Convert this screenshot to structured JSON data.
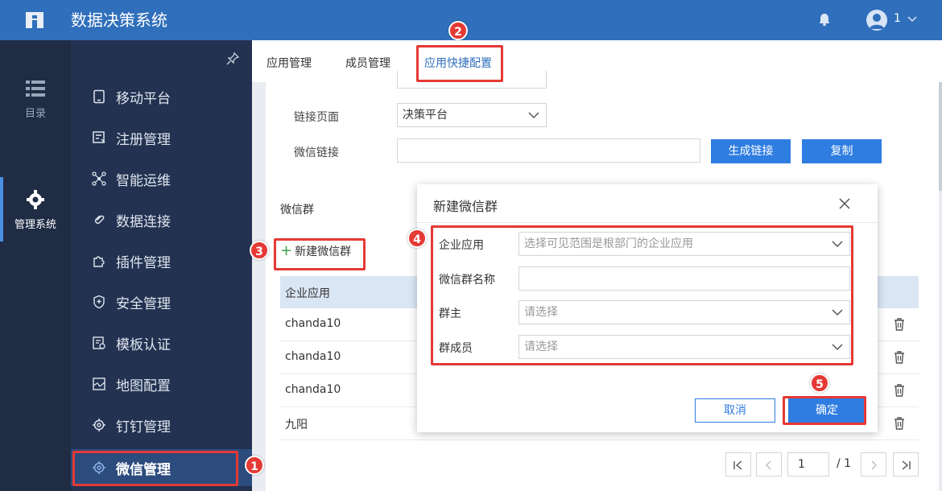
{
  "header": {
    "title": "数据决策系统",
    "logo_icon": "fine-logo-icon",
    "notification_icon": "bell-icon",
    "user": {
      "avatar_icon": "user-avatar-icon",
      "name": "1",
      "chevron_icon": "chevron-down-icon"
    }
  },
  "rail": {
    "items": [
      {
        "label": "目录",
        "icon": "list-icon"
      },
      {
        "label": "管理系统",
        "icon": "gear-icon"
      }
    ]
  },
  "sidebar": {
    "pin_icon": "pin-icon",
    "items": [
      {
        "label": "移动平台",
        "icon": "tablet-icon"
      },
      {
        "label": "注册管理",
        "icon": "register-icon"
      },
      {
        "label": "智能运维",
        "icon": "network-icon"
      },
      {
        "label": "数据连接",
        "icon": "link-icon"
      },
      {
        "label": "插件管理",
        "icon": "puzzle-icon"
      },
      {
        "label": "安全管理",
        "icon": "shield-icon"
      },
      {
        "label": "模板认证",
        "icon": "template-icon"
      },
      {
        "label": "地图配置",
        "icon": "map-icon"
      },
      {
        "label": "钉钉管理",
        "icon": "gear-icon"
      },
      {
        "label": "微信管理",
        "icon": "gear-icon"
      }
    ]
  },
  "tabs": [
    {
      "label": "应用管理"
    },
    {
      "label": "成员管理"
    },
    {
      "label": "应用快捷配置"
    }
  ],
  "link_config": {
    "link_page_label": "链接页面",
    "link_page_value": "决策平台",
    "wechat_link_label": "微信链接",
    "wechat_link_value": "",
    "generate_button": "生成链接",
    "copy_button": "复制"
  },
  "wechat_group": {
    "title": "微信群",
    "new_button": "新建微信群",
    "columns": [
      "企业应用"
    ],
    "rows": [
      {
        "app": "chanda10"
      },
      {
        "app": "chanda10"
      },
      {
        "app": "chanda10"
      },
      {
        "app": "九阳"
      }
    ]
  },
  "pagination": {
    "current": "1",
    "total": "/ 1"
  },
  "dialog": {
    "title": "新建微信群",
    "fields": [
      {
        "label": "企业应用",
        "placeholder": "选择可见范围是根部门的企业应用",
        "type": "select"
      },
      {
        "label": "微信群名称",
        "placeholder": "",
        "type": "text"
      },
      {
        "label": "群主",
        "placeholder": "请选择",
        "type": "select"
      },
      {
        "label": "群成员",
        "placeholder": "请选择",
        "type": "select"
      }
    ],
    "cancel_button": "取消",
    "confirm_button": "确定"
  },
  "annotations": [
    "1",
    "2",
    "3",
    "4",
    "5"
  ],
  "colors": {
    "topbar": "#2f6fbb",
    "sidebar": "#233251",
    "accent": "#2f7de1",
    "highlight": "#e53935"
  }
}
